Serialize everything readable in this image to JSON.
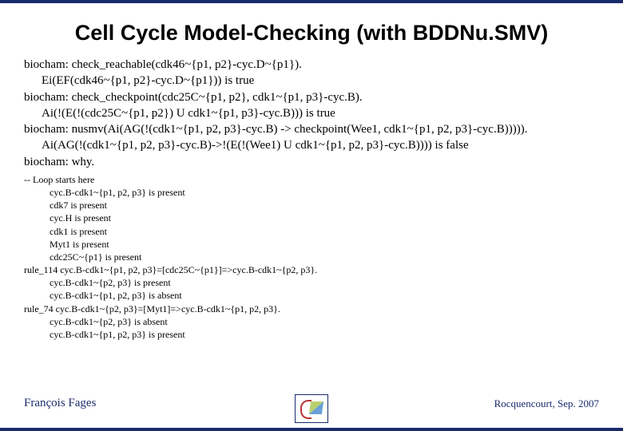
{
  "title": "Cell Cycle Model-Checking (with BDDNu.SMV)",
  "lines": {
    "l0": "biocham: check_reachable(cdk46~{p1, p2}-cyc.D~{p1}).",
    "l1": "Ei(EF(cdk46~{p1, p2}-cyc.D~{p1})) is true",
    "l2": "biocham: check_checkpoint(cdc25C~{p1, p2}, cdk1~{p1, p3}-cyc.B).",
    "l3": "Ai(!(E(!(cdc25C~{p1, p2}) U cdk1~{p1, p3}-cyc.B))) is true",
    "l4": "biocham: nusmv(Ai(AG(!(cdk1~{p1, p2, p3}-cyc.B) -> checkpoint(Wee1, cdk1~{p1, p2, p3}-cyc.B))))).",
    "l5": "Ai(AG(!(cdk1~{p1, p2, p3}-cyc.B)->!(E(!(Wee1) U cdk1~{p1, p2, p3}-cyc.B)))) is false",
    "l6": "biocham: why."
  },
  "trace": {
    "t0": "-- Loop starts here",
    "t1": "cyc.B-cdk1~{p1, p2, p3} is present",
    "t2": "cdk7 is present",
    "t3": "cyc.H is present",
    "t4": "cdk1 is present",
    "t5": "Myt1 is present",
    "t6": "cdc25C~{p1} is present",
    "t7": "rule_114 cyc.B-cdk1~{p1, p2, p3}=[cdc25C~{p1}]=>cyc.B-cdk1~{p2, p3}.",
    "t8": "cyc.B-cdk1~{p2, p3} is present",
    "t9": "cyc.B-cdk1~{p1, p2, p3} is absent",
    "t10": "rule_74 cyc.B-cdk1~{p2, p3}=[Myt1]=>cyc.B-cdk1~{p1, p2, p3}.",
    "t11": "cyc.B-cdk1~{p2, p3} is absent",
    "t12": "cyc.B-cdk1~{p1, p2, p3} is present"
  },
  "footer": {
    "author": "François Fages",
    "venue": "Rocquencourt, Sep. 2007"
  }
}
